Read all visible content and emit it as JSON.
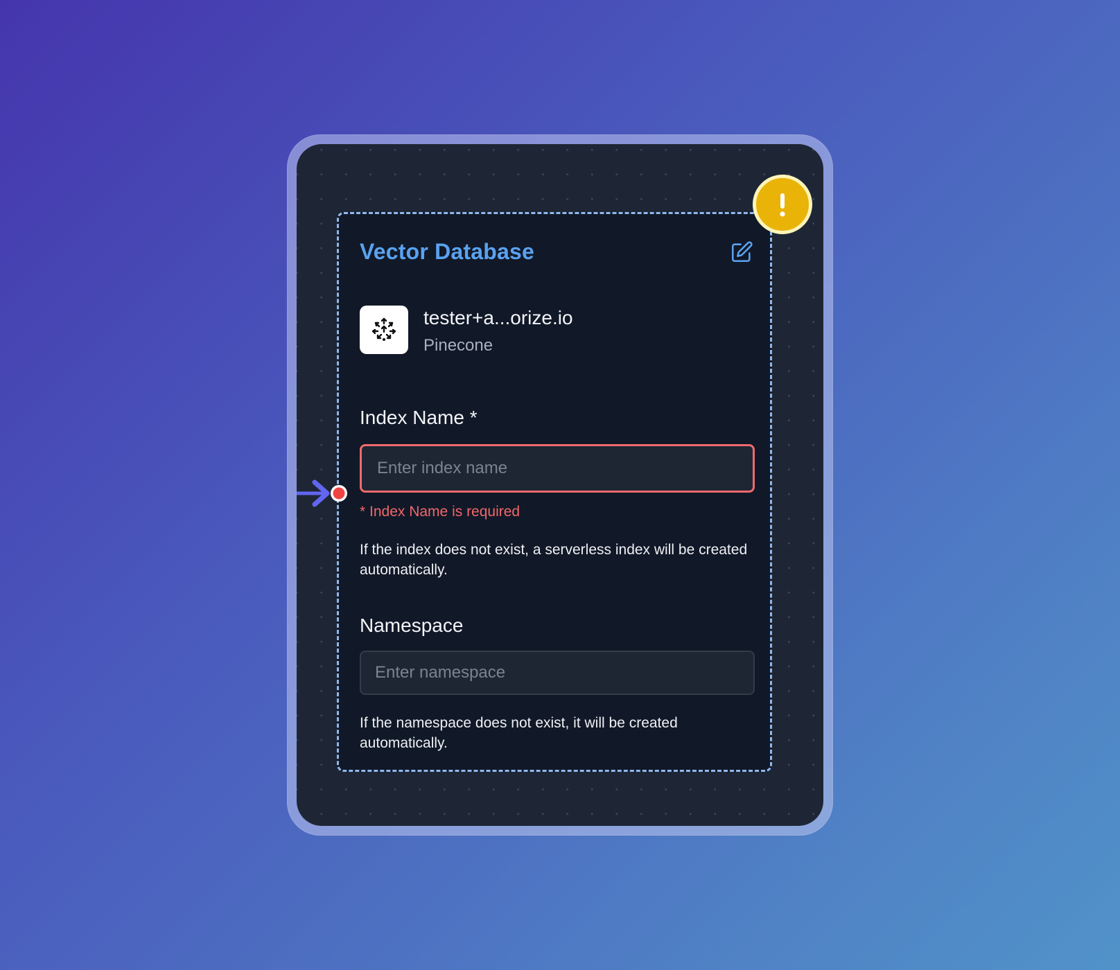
{
  "node": {
    "title": "Vector Database",
    "account": {
      "name": "tester+a...orize.io",
      "provider": "Pinecone"
    },
    "index_name": {
      "label": "Index Name *",
      "value": "",
      "placeholder": "Enter index name",
      "error": "* Index Name is required",
      "help": "If the index does not exist, a serverless index will be created automatically."
    },
    "namespace": {
      "label": "Namespace",
      "value": "",
      "placeholder": "Enter namespace",
      "help": "If the namespace does not exist, it will be created automatically."
    }
  },
  "icons": {
    "edit": "edit-icon",
    "logo": "pinecone-logo-icon",
    "warning": "warning-icon",
    "connector": "connection-handle-icon"
  },
  "colors": {
    "title": "#5aa2f0",
    "error": "#f06a6e",
    "warning": "#eab308",
    "canvas": "#1e2635",
    "node": "#111827",
    "node_border": "#8fb8ec",
    "connector_arrow": "#6366f1",
    "connector_dot": "#ef4444"
  }
}
